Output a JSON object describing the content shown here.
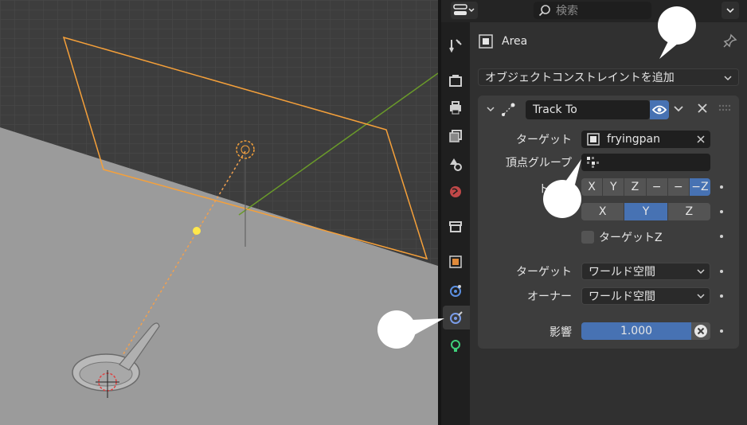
{
  "search": {
    "placeholder": "検索"
  },
  "object": {
    "name": "Area"
  },
  "add_constraint": {
    "label": "オブジェクトコンストレイントを追加"
  },
  "constraint": {
    "name": "Track To",
    "target_label": "ターゲット",
    "target_value": "fryingpan",
    "vertex_group_label": "頂点グループ",
    "track_axis_label": "トラッ",
    "track_axis_options": [
      "X",
      "Y",
      "Z",
      "−",
      "−",
      "−Z"
    ],
    "track_axis_selected": "−Z",
    "up_axis_options": [
      "X",
      "Y",
      "Z"
    ],
    "up_axis_selected": "Y",
    "target_z_label": "ターゲットZ",
    "target_space_label": "ターゲット",
    "target_space_value": "ワールド空間",
    "owner_space_label": "オーナー",
    "owner_space_value": "ワールド空間",
    "influence_label": "影響",
    "influence_value": "1.000"
  },
  "tabs": [
    "tool",
    "render",
    "output",
    "view-layer",
    "scene",
    "world",
    "collection",
    "object",
    "modifiers",
    "object-constraints",
    "object-data-light"
  ],
  "active_tab": "object-constraints",
  "colors": {
    "accent": "#4772b3",
    "selection": "#f5a03a",
    "light": "#ffe84a"
  }
}
